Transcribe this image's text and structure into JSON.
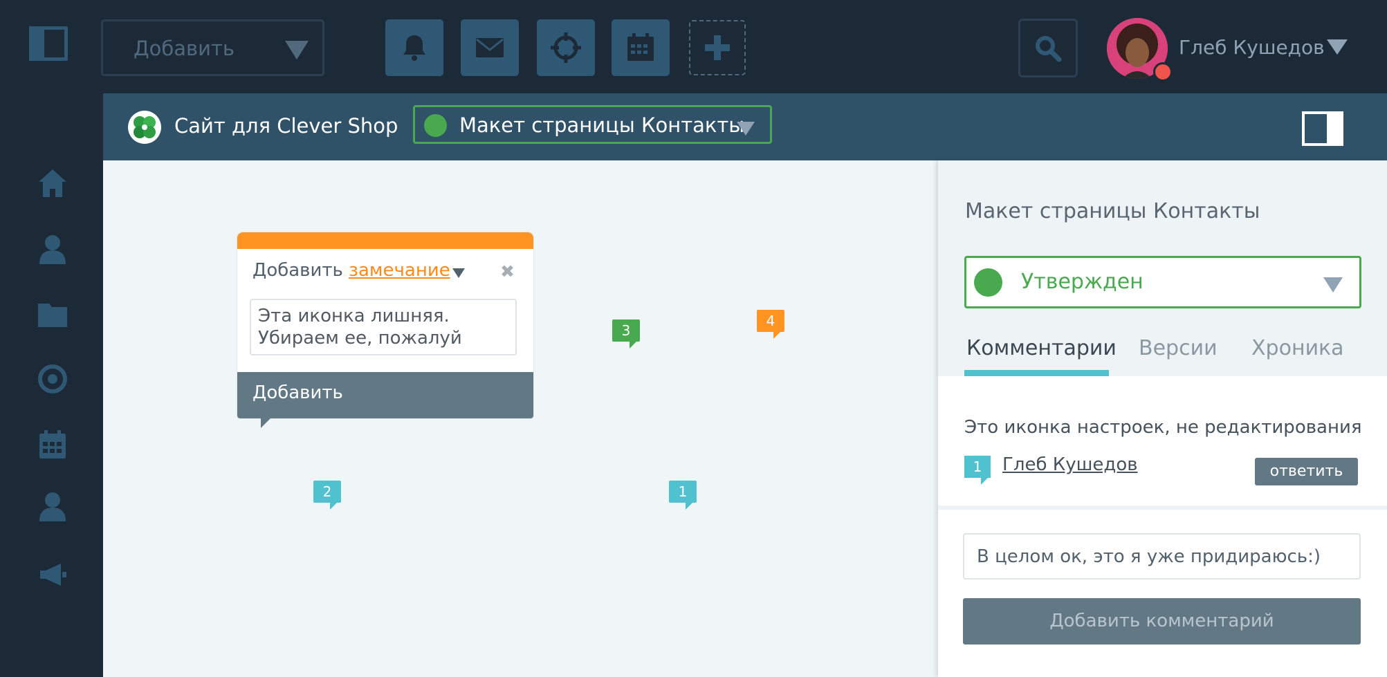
{
  "topbar": {
    "add_dropdown_label": "Добавить",
    "user_name": "Глеб Кушедов"
  },
  "project": {
    "name": "Сайт для Clever Shop",
    "page_select_label": "Макет страницы Контакты"
  },
  "canvas": {
    "pins": [
      {
        "number": "3",
        "color": "#49a94f"
      },
      {
        "number": "4",
        "color": "#ff9422"
      },
      {
        "number": "2",
        "color": "#4fc1cf"
      },
      {
        "number": "1",
        "color": "#4fc1cf"
      }
    ],
    "note": {
      "title_prefix": "Добавить",
      "title_link": "замечание",
      "text_line1": "Эта иконка лишняя.",
      "text_line2": "Убираем ее, пожалуй",
      "button_label": "Добавить"
    }
  },
  "panel": {
    "title": "Макет страницы Контакты",
    "status_label": "Утвержден",
    "tabs": [
      {
        "label": "Комментарии"
      },
      {
        "label": "Версии"
      },
      {
        "label": "Хроника"
      }
    ],
    "comment": {
      "text": "Это иконка настроек, не редактирования",
      "pin_number": "1",
      "author": "Глеб Кушедов",
      "reply_label": "ответить"
    },
    "input_value": "В целом ок, это я уже придираюсь:)",
    "submit_label": "Добавить комментарий"
  },
  "colors": {
    "accent_green": "#49a94f",
    "accent_orange": "#ff9422",
    "accent_teal": "#4fc1cf",
    "dark_bg": "#1c2a38",
    "toolbar_blue": "#2f5874"
  }
}
